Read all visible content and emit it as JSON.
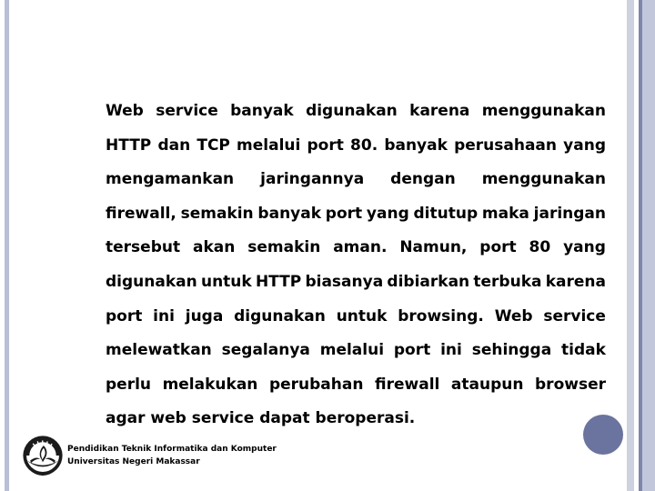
{
  "slide": {
    "paragraph_lines": [
      [
        "Web",
        "service",
        "banyak",
        "digunakan",
        "karena",
        "menggunakan"
      ],
      [
        "HTTP",
        "dan",
        "TCP",
        "melalui",
        "port",
        "80.",
        "banyak",
        "perusahaan",
        "yang"
      ],
      [
        "mengamankan",
        "jaringannya",
        "dengan",
        "menggunakan"
      ],
      [
        "firewall,",
        "semakin",
        "banyak",
        "port",
        "yang",
        "ditutup",
        "maka",
        "jaringan"
      ],
      [
        "tersebut",
        "akan",
        "semakin",
        "aman.",
        "Namun,",
        "port",
        "80",
        "yang"
      ],
      [
        "digunakan",
        "untuk",
        "HTTP",
        "biasanya",
        "dibiarkan",
        "terbuka",
        "karena"
      ],
      [
        "port",
        "ini",
        "juga",
        "digunakan",
        "untuk",
        "browsing.",
        "Web",
        "service"
      ],
      [
        "melewatkan",
        "segalanya",
        "melalui",
        "port",
        "ini",
        "sehingga",
        "tidak"
      ],
      [
        "perlu",
        "melakukan",
        "perubahan",
        "firewall",
        "ataupun",
        "browser"
      ]
    ],
    "paragraph_last_line": "agar web service dapat beroperasi.",
    "paragraph_text": "Web service banyak digunakan karena menggunakan HTTP dan TCP melalui port 80. banyak perusahaan yang mengamankan jaringannya dengan menggunakan firewall, semakin banyak port yang ditutup maka jaringan tersebut akan semakin aman. Namun, port 80 yang digunakan untuk HTTP biasanya dibiarkan terbuka karena port ini juga digunakan untuk browsing. Web service melewatkan segalanya melalui port ini sehingga tidak perlu melakukan perubahan firewall ataupun browser agar web service dapat beroperasi."
  },
  "footer": {
    "logo_name": "unm-university-emblem-icon",
    "line1": "Pendidikan Teknik Informatika dan Komputer",
    "line2": "Universitas Negeri Makassar"
  },
  "decor": {
    "left_rule_color": "#b9bfd4",
    "right_rule_light_color": "#ced2e0",
    "right_rule_dark_color": "#7e87ab",
    "right_rule_wide_color": "#c2c7dc",
    "corner_dot_color": "#6b749e"
  }
}
